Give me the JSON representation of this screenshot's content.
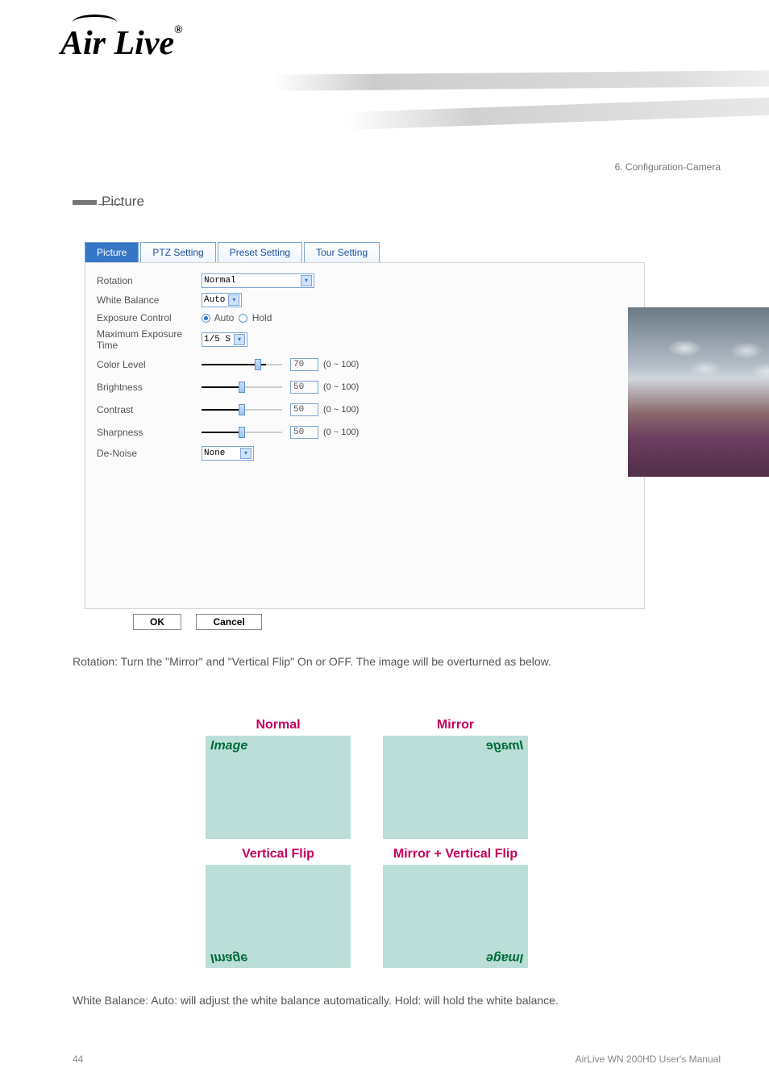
{
  "header": {
    "brand": "Air Live",
    "chapter": "6. Configuration-Camera"
  },
  "section": {
    "title_prefix": "▌",
    "title": "Picture"
  },
  "tabs": [
    "Picture",
    "PTZ Setting",
    "Preset Setting",
    "Tour Setting"
  ],
  "form": {
    "rotation_label": "Rotation",
    "rotation_value": "Normal",
    "white_balance_label": "White Balance",
    "white_balance_value": "Auto",
    "exposure_label": "Exposure Control",
    "exposure_auto": "Auto",
    "exposure_hold": "Hold",
    "max_exposure_label": "Maximum Exposure Time",
    "max_exposure_value": "1/5 S",
    "color_level_label": "Color Level",
    "color_level_value": "70",
    "brightness_label": "Brightness",
    "brightness_value": "50",
    "contrast_label": "Contrast",
    "contrast_value": "50",
    "sharpness_label": "Sharpness",
    "sharpness_value": "50",
    "range": "(0 ~ 100)",
    "denoise_label": "De-Noise",
    "denoise_value": "None",
    "ok": "OK",
    "cancel": "Cancel"
  },
  "descriptions": {
    "rotation": "Rotation: Turn the \"Mirror\" and \"Vertical Flip\" On or OFF. The image will be overturned as below.",
    "white_balance": "White Balance: Auto: will adjust the white balance automatically. Hold: will hold the white balance."
  },
  "diagram": {
    "normal": "Normal",
    "mirror": "Mirror",
    "vflip": "Vertical Flip",
    "mvflip": "Mirror + Vertical Flip",
    "label": "Image"
  },
  "footer": {
    "page": "44",
    "product": "AirLive WN 200HD User's Manual"
  }
}
